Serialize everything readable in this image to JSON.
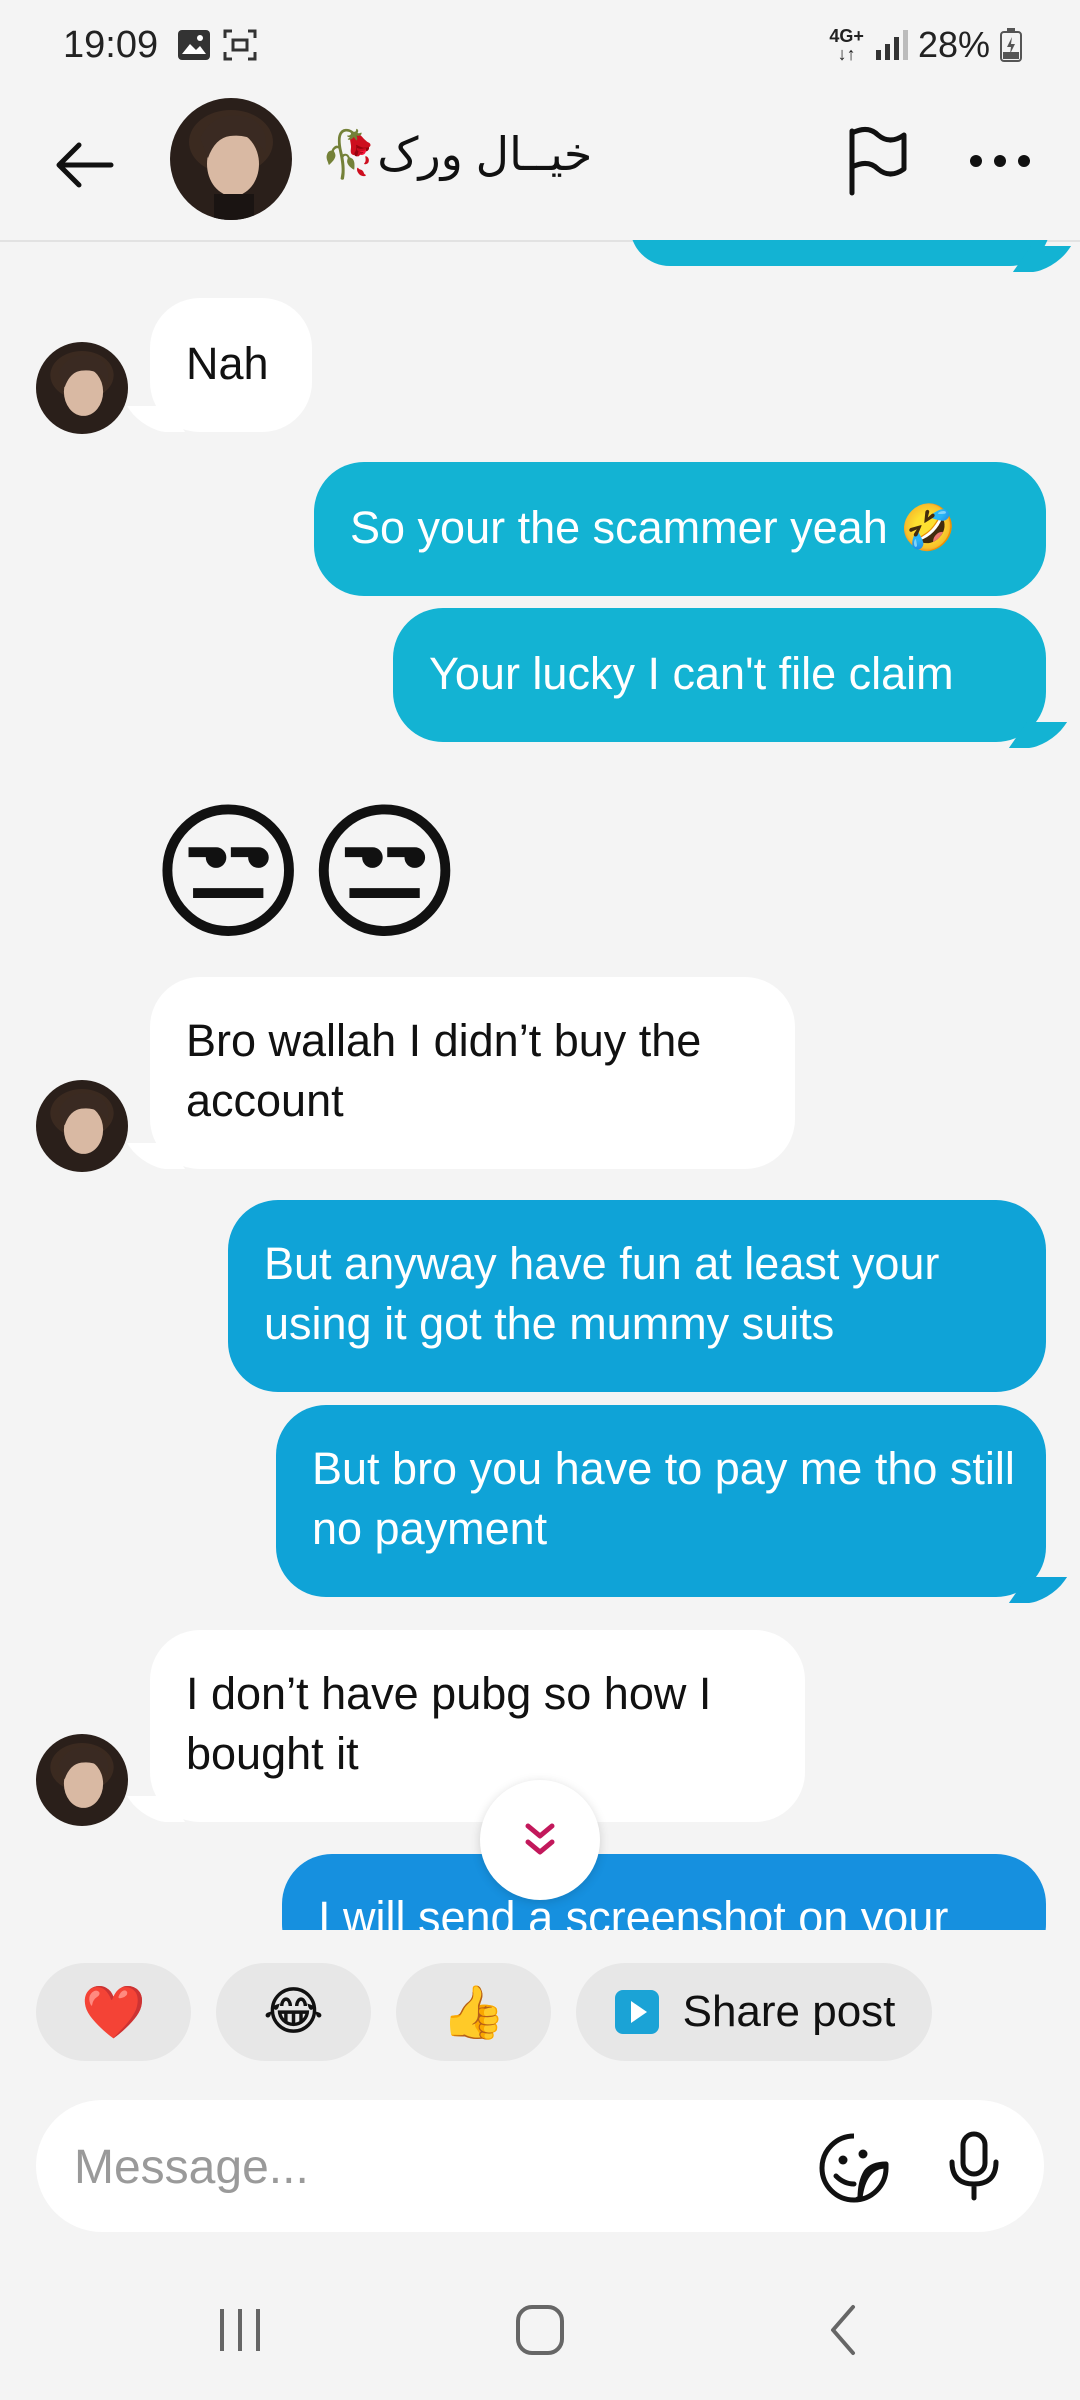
{
  "status": {
    "time": "19:09",
    "network_top": "4G+",
    "battery": "28%"
  },
  "header": {
    "contact_name": "🥀خیــال ⁩ورک⁦"
  },
  "messages": [
    {
      "dir": "in",
      "text": "Nah"
    },
    {
      "dir": "out",
      "text": "So your the scammer yeah 🤣"
    },
    {
      "dir": "out",
      "text": "Your lucky I can't file claim"
    },
    {
      "dir": "in",
      "text": "😒😒"
    },
    {
      "dir": "in",
      "text": "Bro wallah I didn’t buy the account"
    },
    {
      "dir": "out",
      "text": "But anyway have fun at least your using it got the mummy suits"
    },
    {
      "dir": "out",
      "text": "But bro you have to pay me tho still no payment"
    },
    {
      "dir": "in",
      "text": "I don’t have pubg so how I bought it"
    },
    {
      "dir": "out",
      "text": "I will send a screenshot on your"
    }
  ],
  "reactions": {
    "heart": "❤️",
    "laugh": "😂",
    "thumbs": "👍",
    "share_label": "Share post"
  },
  "composer": {
    "placeholder": "Message..."
  },
  "colors": {
    "accent": "#13b3d3",
    "accent_mid": "#0fa3d7",
    "accent_deep": "#1690df",
    "background": "#f4f4f4"
  },
  "icons": [
    "back-arrow-icon",
    "flag-icon",
    "more-icon",
    "chevron-double-down-icon",
    "play-square-icon",
    "sticker-icon",
    "mic-icon",
    "recents-icon",
    "home-icon",
    "nav-back-icon"
  ]
}
